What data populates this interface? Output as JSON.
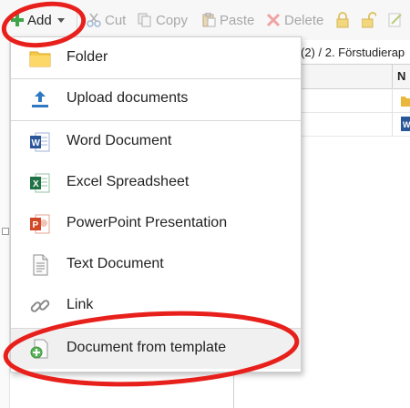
{
  "toolbar": {
    "add_label": "Add",
    "cut_label": "Cut",
    "copy_label": "Copy",
    "paste_label": "Paste",
    "delete_label": "Delete"
  },
  "breadcrumb": "(2) / 2. Förstudierap",
  "column_header": "N",
  "menu": {
    "items": [
      {
        "label": "Folder",
        "icon": "folder-icon"
      },
      {
        "label": "Upload documents",
        "icon": "upload-icon"
      },
      {
        "label": "Word Document",
        "icon": "word-icon"
      },
      {
        "label": "Excel Spreadsheet",
        "icon": "excel-icon"
      },
      {
        "label": "PowerPoint Presentation",
        "icon": "powerpoint-icon"
      },
      {
        "label": "Text Document",
        "icon": "text-document-icon"
      },
      {
        "label": "Link",
        "icon": "link-icon"
      },
      {
        "label": "Document from template",
        "icon": "template-icon"
      }
    ]
  },
  "colors": {
    "annotation_red": "#e8201c",
    "word_blue": "#2b579a",
    "excel_green": "#217346",
    "powerpoint_red": "#d24726",
    "add_green": "#3fa54a",
    "folder_yellow": "#f7c948",
    "upload_blue": "#2f79c2"
  }
}
